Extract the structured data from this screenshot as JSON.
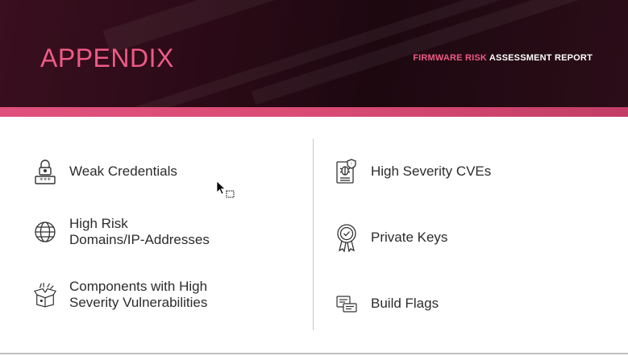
{
  "header": {
    "title": "APPENDIX",
    "report_highlight": "FIRMWARE RISK",
    "report_rest": "ASSESSMENT REPORT",
    "accent_color": "#ee5a86"
  },
  "left_items": [
    {
      "label": "Weak Credentials",
      "icon": "lock-password-icon"
    },
    {
      "label": "High Risk\nDomains/IP-Addresses",
      "icon": "globe-icon"
    },
    {
      "label": "Components with High\nSeverity Vulnerabilities",
      "icon": "open-box-icon"
    }
  ],
  "right_items": [
    {
      "label": "High Severity CVEs",
      "icon": "bug-document-icon"
    },
    {
      "label": "Private Keys",
      "icon": "certificate-badge-icon"
    },
    {
      "label": "Build Flags",
      "icon": "flag-cards-icon"
    }
  ]
}
